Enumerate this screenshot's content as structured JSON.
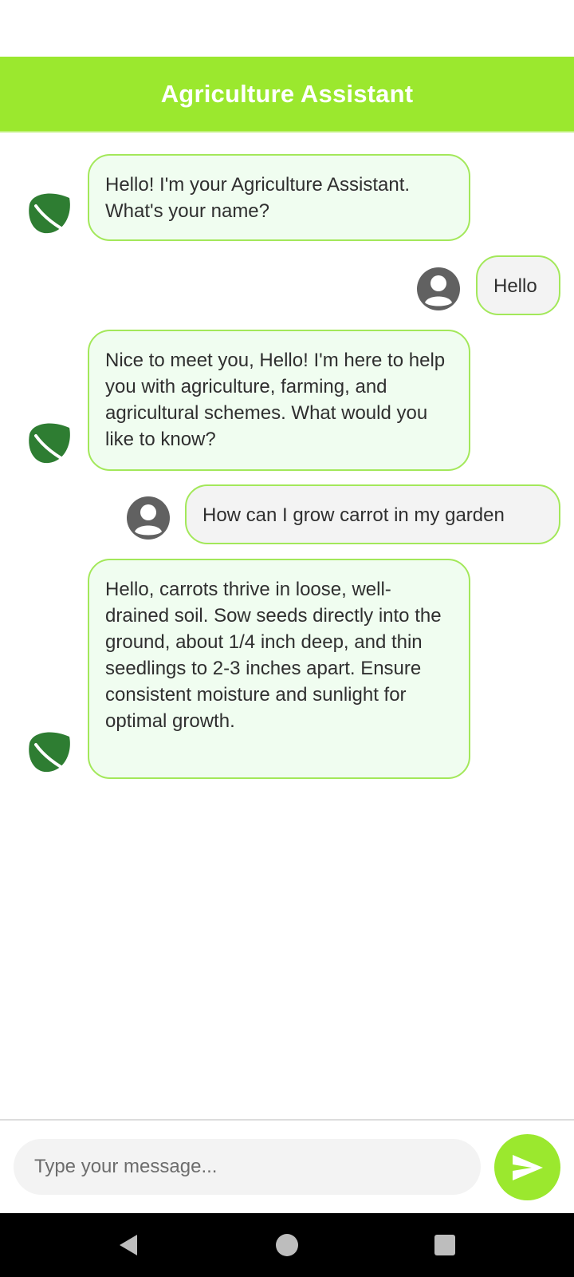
{
  "header": {
    "title": "Agriculture Assistant"
  },
  "messages": [
    {
      "sender": "bot",
      "text": "Hello! I'm your Agriculture Assistant. What's your name?"
    },
    {
      "sender": "user",
      "text": "Hello"
    },
    {
      "sender": "bot",
      "text": "Nice to meet you, Hello! I'm here to help you with agriculture, farming, and agricultural schemes. What would you like to know?"
    },
    {
      "sender": "user",
      "text": "How can I grow carrot in my garden"
    },
    {
      "sender": "bot",
      "text": "Hello, carrots thrive in loose, well-drained soil. Sow seeds directly into the ground, about 1/4 inch deep, and thin seedlings to 2-3 inches apart. Ensure consistent moisture and sunlight for optimal growth."
    }
  ],
  "composer": {
    "placeholder": "Type your message...",
    "value": ""
  },
  "icons": {
    "bot_avatar": "leaf-icon",
    "user_avatar": "user-icon",
    "send": "send-icon",
    "nav_back": "back-triangle-icon",
    "nav_home": "home-circle-icon",
    "nav_recents": "recents-square-icon"
  },
  "colors": {
    "accent": "#9be82e",
    "bot_bubble_bg": "#f0fdf0",
    "bubble_border": "#a3e85a",
    "user_bubble_bg": "#f3f3f3",
    "leaf": "#2e7d32",
    "user_icon": "#616161"
  }
}
